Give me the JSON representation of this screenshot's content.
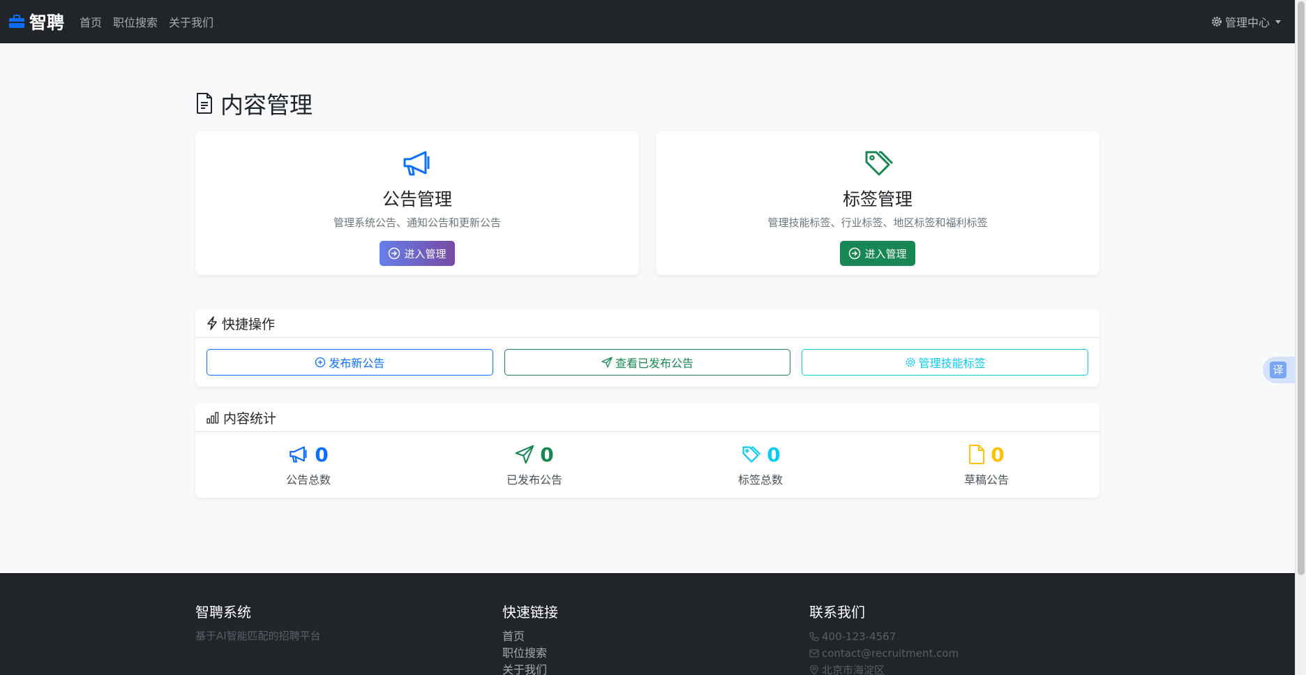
{
  "navbar": {
    "brand": "智聘",
    "links": [
      "首页",
      "职位搜索",
      "关于我们"
    ],
    "admin_menu": "管理中心"
  },
  "page": {
    "title": "内容管理"
  },
  "mgmt_cards": [
    {
      "title": "公告管理",
      "desc": "管理系统公告、通知公告和更新公告",
      "button": "进入管理"
    },
    {
      "title": "标签管理",
      "desc": "管理技能标签、行业标签、地区标签和福利标签",
      "button": "进入管理"
    }
  ],
  "quick_actions": {
    "title": "快捷操作",
    "buttons": [
      "发布新公告",
      "查看已发布公告",
      "管理技能标签"
    ]
  },
  "stats": {
    "title": "内容统计",
    "items": [
      {
        "value": "0",
        "label": "公告总数",
        "color": "#0d6efd",
        "icon": "megaphone-icon"
      },
      {
        "value": "0",
        "label": "已发布公告",
        "color": "#198754",
        "icon": "send-icon"
      },
      {
        "value": "0",
        "label": "标签总数",
        "color": "#0dcaf0",
        "icon": "tags-icon"
      },
      {
        "value": "0",
        "label": "草稿公告",
        "color": "#ffc107",
        "icon": "file-icon"
      }
    ]
  },
  "translate": {
    "label": "译"
  },
  "footer": {
    "about": {
      "title": "智聘系统",
      "desc": "基于AI智能匹配的招聘平台"
    },
    "links": {
      "title": "快速链接",
      "items": [
        "首页",
        "职位搜索",
        "关于我们"
      ]
    },
    "contact": {
      "title": "联系我们",
      "phone": "400-123-4567",
      "email": "contact@recruitment.com",
      "address": "北京市海淀区"
    }
  },
  "colors": {
    "primary": "#0d6efd",
    "success": "#198754",
    "info": "#0dcaf0",
    "warning": "#ffc107",
    "dark": "#212529"
  }
}
